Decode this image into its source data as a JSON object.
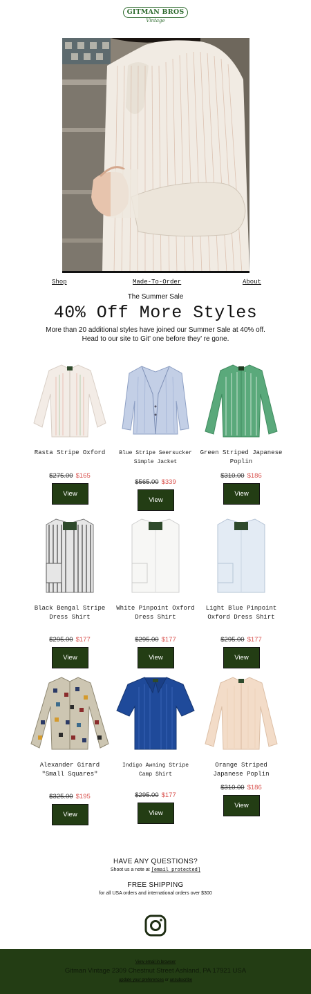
{
  "brand": {
    "logo_main": "GITMAN BROS",
    "logo_sub": "Vintage"
  },
  "nav": {
    "shop": "Shop",
    "made_to_order": "Made-To-Order",
    "about": "About"
  },
  "hero": {
    "eyebrow": "The Summer Sale",
    "headline": "40% Off More Styles",
    "sub": "More than 20 additional styles have joined our Summer Sale at 40% off. Head to our site to Git’ one before they’ re gone."
  },
  "products": [
    {
      "name": "Rasta Stripe Oxford",
      "old": "$275.00",
      "new": "$165",
      "cta": "View"
    },
    {
      "name": "Blue Stripe Seersucker Simple Jacket",
      "old": "$565.00",
      "new": "$339",
      "cta": "View"
    },
    {
      "name": "Green Striped Japanese Poplin",
      "old": "$310.00",
      "new": "$186",
      "cta": "View"
    },
    {
      "name": "Black Bengal Stripe Dress Shirt",
      "old": "$295.00",
      "new": "$177",
      "cta": "View"
    },
    {
      "name": "White Pinpoint Oxford Dress Shirt",
      "old": "$295.00",
      "new": "$177",
      "cta": "View"
    },
    {
      "name": "Light Blue Pinpoint Oxford Dress Shirt",
      "old": "$295.00",
      "new": "$177",
      "cta": "View"
    },
    {
      "name": "Alexander Girard \"Small Squares\"",
      "old": "$325.00",
      "new": "$195",
      "cta": "View"
    },
    {
      "name": "Indigo Awning Stripe Camp Shirt",
      "old": "$295.00",
      "new": "$177",
      "cta": "View"
    },
    {
      "name": "Orange Striped Japanese Poplin",
      "old": "$310.00",
      "new": "$186",
      "cta": "View"
    }
  ],
  "questions": {
    "title": "HAVE ANY QUESTIONS?",
    "note_prefix": "Shoot us a note at",
    "email": "[email protected]"
  },
  "shipping": {
    "title": "FREE SHIPPING",
    "note": "for all USA orders and international orders over $300"
  },
  "social": {
    "icon": "instagram-icon"
  },
  "footer": {
    "view_email": "View email in browser",
    "address": "Gitman Vintage   2309 Chestnut Street   Ashland, PA 17921   USA",
    "prefs": "update your preferences",
    "or": "or",
    "unsubscribe": "unsubscribe"
  },
  "colors": {
    "button_bg": "#233d14",
    "footer_bg": "#233d14",
    "sale_price": "#d9534f",
    "logo": "#2e6b2e"
  }
}
